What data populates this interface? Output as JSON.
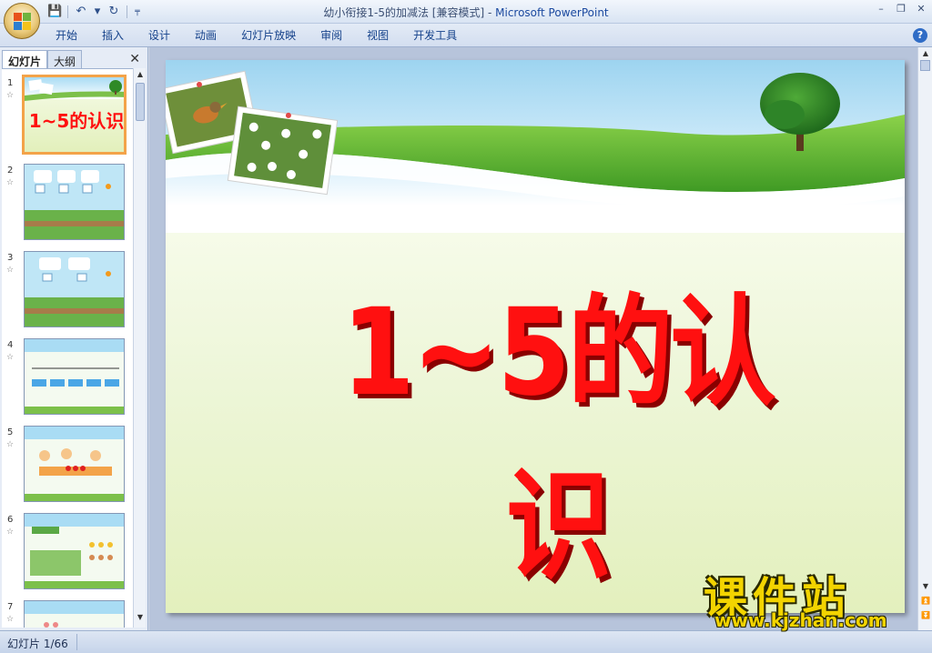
{
  "window": {
    "title": "幼小衔接1-5的加减法 [兼容模式]",
    "title_sep": " - ",
    "app_name": "Microsoft PowerPoint",
    "min_symbol": "–",
    "restore_symbol": "❐",
    "close_symbol": "✕"
  },
  "qat": {
    "save": "💾",
    "undo": "↶",
    "dropdown": "▾",
    "redo": "↻",
    "customize": "╤"
  },
  "ribbon": {
    "tabs": [
      "开始",
      "插入",
      "设计",
      "动画",
      "幻灯片放映",
      "审阅",
      "视图",
      "开发工具"
    ],
    "help": "?"
  },
  "left_pane": {
    "tab_slides": "幻灯片",
    "tab_outline": "大纲",
    "close": "✕",
    "slides": [
      {
        "num": "1",
        "label": "1~5的认识"
      },
      {
        "num": "2"
      },
      {
        "num": "3"
      },
      {
        "num": "4"
      },
      {
        "num": "5"
      },
      {
        "num": "6"
      },
      {
        "num": "7"
      }
    ],
    "star": "☆"
  },
  "slide": {
    "title": "1~5的认识"
  },
  "watermark": {
    "cn": "课件站",
    "url": "www.kjzhan.com"
  },
  "status": {
    "slide_indicator": "幻灯片 1/66"
  },
  "colors": {
    "title_red": "#ff1010",
    "watermark_yellow": "#f3d400",
    "selected_thumb_border": "#f3a349"
  }
}
